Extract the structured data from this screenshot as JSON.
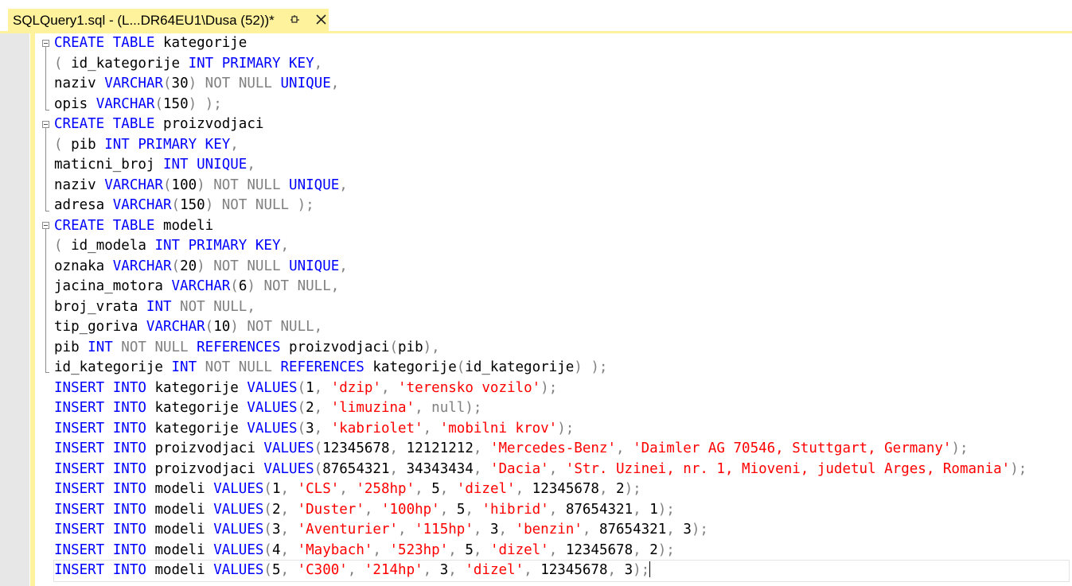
{
  "tab": {
    "title": "SQLQuery1.sql - (L...DR64EU1\\Dusa (52))*",
    "pin_icon": "pin-icon",
    "close_icon": "close-icon"
  },
  "colors": {
    "keyword": "#0000ff",
    "operator": "#808080",
    "string": "#ff0000",
    "tab_background": "#fff29d",
    "gutter": "#e7e7e7"
  },
  "code_lines": [
    [
      [
        "kw",
        "CREATE TABLE"
      ],
      [
        "p",
        " kategorije"
      ]
    ],
    [
      [
        "op",
        "("
      ],
      [
        "p",
        " id_kategorije "
      ],
      [
        "kw",
        "INT PRIMARY KEY"
      ],
      [
        "op",
        ","
      ]
    ],
    [
      [
        "p",
        "naziv "
      ],
      [
        "kw",
        "VARCHAR"
      ],
      [
        "op",
        "("
      ],
      [
        "p",
        "30"
      ],
      [
        "op",
        ") NOT NULL "
      ],
      [
        "kw",
        "UNIQUE"
      ],
      [
        "op",
        ","
      ]
    ],
    [
      [
        "p",
        "opis "
      ],
      [
        "kw",
        "VARCHAR"
      ],
      [
        "op",
        "("
      ],
      [
        "p",
        "150"
      ],
      [
        "op",
        ") );"
      ]
    ],
    [
      [
        "kw",
        "CREATE TABLE"
      ],
      [
        "p",
        " proizvodjaci"
      ]
    ],
    [
      [
        "op",
        "("
      ],
      [
        "p",
        " pib "
      ],
      [
        "kw",
        "INT PRIMARY KEY"
      ],
      [
        "op",
        ","
      ]
    ],
    [
      [
        "p",
        "maticni_broj "
      ],
      [
        "kw",
        "INT UNIQUE"
      ],
      [
        "op",
        ","
      ]
    ],
    [
      [
        "p",
        "naziv "
      ],
      [
        "kw",
        "VARCHAR"
      ],
      [
        "op",
        "("
      ],
      [
        "p",
        "100"
      ],
      [
        "op",
        ") NOT NULL "
      ],
      [
        "kw",
        "UNIQUE"
      ],
      [
        "op",
        ","
      ]
    ],
    [
      [
        "p",
        "adresa "
      ],
      [
        "kw",
        "VARCHAR"
      ],
      [
        "op",
        "("
      ],
      [
        "p",
        "150"
      ],
      [
        "op",
        ") NOT NULL );"
      ]
    ],
    [
      [
        "kw",
        "CREATE TABLE"
      ],
      [
        "p",
        " modeli"
      ]
    ],
    [
      [
        "op",
        "("
      ],
      [
        "p",
        " id_modela "
      ],
      [
        "kw",
        "INT PRIMARY KEY"
      ],
      [
        "op",
        ","
      ]
    ],
    [
      [
        "p",
        "oznaka "
      ],
      [
        "kw",
        "VARCHAR"
      ],
      [
        "op",
        "("
      ],
      [
        "p",
        "20"
      ],
      [
        "op",
        ") NOT NULL "
      ],
      [
        "kw",
        "UNIQUE"
      ],
      [
        "op",
        ","
      ]
    ],
    [
      [
        "p",
        "jacina_motora "
      ],
      [
        "kw",
        "VARCHAR"
      ],
      [
        "op",
        "("
      ],
      [
        "p",
        "6"
      ],
      [
        "op",
        ") NOT NULL,"
      ]
    ],
    [
      [
        "p",
        "broj_vrata "
      ],
      [
        "kw",
        "INT"
      ],
      [
        "op",
        " NOT NULL,"
      ]
    ],
    [
      [
        "p",
        "tip_goriva "
      ],
      [
        "kw",
        "VARCHAR"
      ],
      [
        "op",
        "("
      ],
      [
        "p",
        "10"
      ],
      [
        "op",
        ") NOT NULL,"
      ]
    ],
    [
      [
        "p",
        "pib "
      ],
      [
        "kw",
        "INT"
      ],
      [
        "op",
        " NOT NULL "
      ],
      [
        "kw",
        "REFERENCES"
      ],
      [
        "p",
        " proizvodjaci"
      ],
      [
        "op",
        "("
      ],
      [
        "p",
        "pib"
      ],
      [
        "op",
        "),"
      ]
    ],
    [
      [
        "p",
        "id_kategorije "
      ],
      [
        "kw",
        "INT"
      ],
      [
        "op",
        " NOT NULL "
      ],
      [
        "kw",
        "REFERENCES"
      ],
      [
        "p",
        " kategorije"
      ],
      [
        "op",
        "("
      ],
      [
        "p",
        "id_kategorije"
      ],
      [
        "op",
        ") );"
      ]
    ],
    [
      [
        "kw",
        "INSERT INTO"
      ],
      [
        "p",
        " kategorije "
      ],
      [
        "kw",
        "VALUES"
      ],
      [
        "op",
        "("
      ],
      [
        "p",
        "1"
      ],
      [
        "op",
        ", "
      ],
      [
        "str",
        "'dzip'"
      ],
      [
        "op",
        ", "
      ],
      [
        "str",
        "'terensko vozilo'"
      ],
      [
        "op",
        ");"
      ]
    ],
    [
      [
        "kw",
        "INSERT INTO"
      ],
      [
        "p",
        " kategorije "
      ],
      [
        "kw",
        "VALUES"
      ],
      [
        "op",
        "("
      ],
      [
        "p",
        "2"
      ],
      [
        "op",
        ", "
      ],
      [
        "str",
        "'limuzina'"
      ],
      [
        "op",
        ", null);"
      ]
    ],
    [
      [
        "kw",
        "INSERT INTO"
      ],
      [
        "p",
        " kategorije "
      ],
      [
        "kw",
        "VALUES"
      ],
      [
        "op",
        "("
      ],
      [
        "p",
        "3"
      ],
      [
        "op",
        ", "
      ],
      [
        "str",
        "'kabriolet'"
      ],
      [
        "op",
        ", "
      ],
      [
        "str",
        "'mobilni krov'"
      ],
      [
        "op",
        ");"
      ]
    ],
    [
      [
        "kw",
        "INSERT INTO"
      ],
      [
        "p",
        " proizvodjaci "
      ],
      [
        "kw",
        "VALUES"
      ],
      [
        "op",
        "("
      ],
      [
        "p",
        "12345678"
      ],
      [
        "op",
        ", "
      ],
      [
        "p",
        "12121212"
      ],
      [
        "op",
        ", "
      ],
      [
        "str",
        "'Mercedes-Benz'"
      ],
      [
        "op",
        ", "
      ],
      [
        "str",
        "'Daimler AG 70546, Stuttgart, Germany'"
      ],
      [
        "op",
        ");"
      ]
    ],
    [
      [
        "kw",
        "INSERT INTO"
      ],
      [
        "p",
        " proizvodjaci "
      ],
      [
        "kw",
        "VALUES"
      ],
      [
        "op",
        "("
      ],
      [
        "p",
        "87654321"
      ],
      [
        "op",
        ", "
      ],
      [
        "p",
        "34343434"
      ],
      [
        "op",
        ", "
      ],
      [
        "str",
        "'Dacia'"
      ],
      [
        "op",
        ", "
      ],
      [
        "str",
        "'Str. Uzinei, nr. 1, Mioveni, judetul Arges, Romania'"
      ],
      [
        "op",
        ");"
      ]
    ],
    [
      [
        "kw",
        "INSERT INTO"
      ],
      [
        "p",
        " modeli "
      ],
      [
        "kw",
        "VALUES"
      ],
      [
        "op",
        "("
      ],
      [
        "p",
        "1"
      ],
      [
        "op",
        ", "
      ],
      [
        "str",
        "'CLS'"
      ],
      [
        "op",
        ", "
      ],
      [
        "str",
        "'258hp'"
      ],
      [
        "op",
        ", "
      ],
      [
        "p",
        "5"
      ],
      [
        "op",
        ", "
      ],
      [
        "str",
        "'dizel'"
      ],
      [
        "op",
        ", "
      ],
      [
        "p",
        "12345678"
      ],
      [
        "op",
        ", "
      ],
      [
        "p",
        "2"
      ],
      [
        "op",
        ");"
      ]
    ],
    [
      [
        "kw",
        "INSERT INTO"
      ],
      [
        "p",
        " modeli "
      ],
      [
        "kw",
        "VALUES"
      ],
      [
        "op",
        "("
      ],
      [
        "p",
        "2"
      ],
      [
        "op",
        ", "
      ],
      [
        "str",
        "'Duster'"
      ],
      [
        "op",
        ", "
      ],
      [
        "str",
        "'100hp'"
      ],
      [
        "op",
        ", "
      ],
      [
        "p",
        "5"
      ],
      [
        "op",
        ", "
      ],
      [
        "str",
        "'hibrid'"
      ],
      [
        "op",
        ", "
      ],
      [
        "p",
        "87654321"
      ],
      [
        "op",
        ", "
      ],
      [
        "p",
        "1"
      ],
      [
        "op",
        ");"
      ]
    ],
    [
      [
        "kw",
        "INSERT INTO"
      ],
      [
        "p",
        " modeli "
      ],
      [
        "kw",
        "VALUES"
      ],
      [
        "op",
        "("
      ],
      [
        "p",
        "3"
      ],
      [
        "op",
        ", "
      ],
      [
        "str",
        "'Aventurier'"
      ],
      [
        "op",
        ", "
      ],
      [
        "str",
        "'115hp'"
      ],
      [
        "op",
        ", "
      ],
      [
        "p",
        "3"
      ],
      [
        "op",
        ", "
      ],
      [
        "str",
        "'benzin'"
      ],
      [
        "op",
        ", "
      ],
      [
        "p",
        "87654321"
      ],
      [
        "op",
        ", "
      ],
      [
        "p",
        "3"
      ],
      [
        "op",
        ");"
      ]
    ],
    [
      [
        "kw",
        "INSERT INTO"
      ],
      [
        "p",
        " modeli "
      ],
      [
        "kw",
        "VALUES"
      ],
      [
        "op",
        "("
      ],
      [
        "p",
        "4"
      ],
      [
        "op",
        ", "
      ],
      [
        "str",
        "'Maybach'"
      ],
      [
        "op",
        ", "
      ],
      [
        "str",
        "'523hp'"
      ],
      [
        "op",
        ", "
      ],
      [
        "p",
        "5"
      ],
      [
        "op",
        ", "
      ],
      [
        "str",
        "'dizel'"
      ],
      [
        "op",
        ", "
      ],
      [
        "p",
        "12345678"
      ],
      [
        "op",
        ", "
      ],
      [
        "p",
        "2"
      ],
      [
        "op",
        ");"
      ]
    ],
    [
      [
        "kw",
        "INSERT INTO"
      ],
      [
        "p",
        " modeli "
      ],
      [
        "kw",
        "VALUES"
      ],
      [
        "op",
        "("
      ],
      [
        "p",
        "5"
      ],
      [
        "op",
        ", "
      ],
      [
        "str",
        "'C300'"
      ],
      [
        "op",
        ", "
      ],
      [
        "str",
        "'214hp'"
      ],
      [
        "op",
        ", "
      ],
      [
        "p",
        "3"
      ],
      [
        "op",
        ", "
      ],
      [
        "str",
        "'dizel'"
      ],
      [
        "op",
        ", "
      ],
      [
        "p",
        "12345678"
      ],
      [
        "op",
        ", "
      ],
      [
        "p",
        "3"
      ],
      [
        "op",
        ");"
      ]
    ]
  ]
}
